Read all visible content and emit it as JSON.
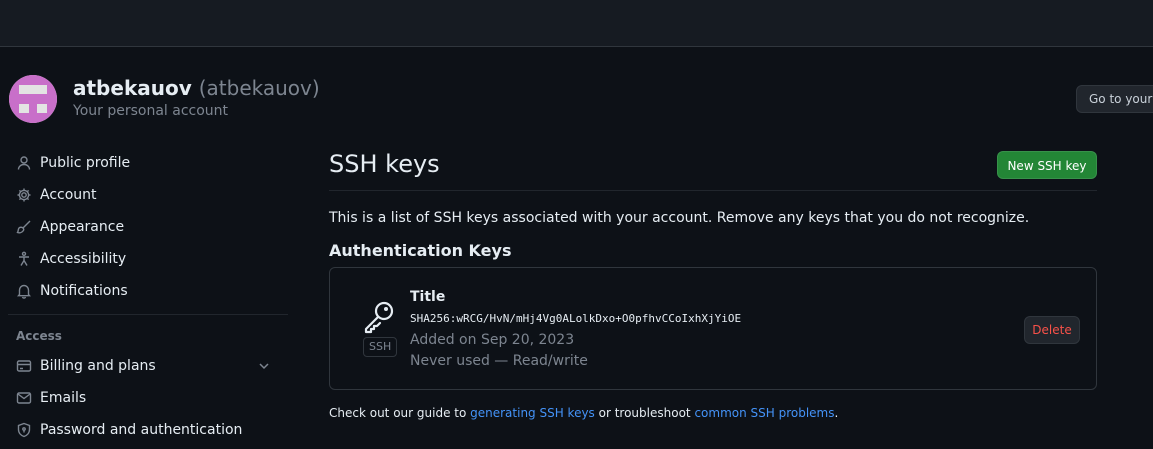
{
  "account": {
    "display_name": "atbekauov",
    "login": "(atbekauov)",
    "subtitle": "Your personal account",
    "goto_label": "Go to your"
  },
  "sidebar": {
    "items": [
      {
        "label": "Public profile",
        "icon": "person-icon"
      },
      {
        "label": "Account",
        "icon": "gear-icon"
      },
      {
        "label": "Appearance",
        "icon": "paintbrush-icon"
      },
      {
        "label": "Accessibility",
        "icon": "accessibility-icon"
      },
      {
        "label": "Notifications",
        "icon": "bell-icon"
      }
    ],
    "access_heading": "Access",
    "access_items": [
      {
        "label": "Billing and plans",
        "icon": "credit-card-icon",
        "expandable": true
      },
      {
        "label": "Emails",
        "icon": "mail-icon"
      },
      {
        "label": "Password and authentication",
        "icon": "shield-lock-icon"
      }
    ]
  },
  "main": {
    "title": "SSH keys",
    "new_key_label": "New SSH key",
    "intro": "This is a list of SSH keys associated with your account. Remove any keys that you do not recognize.",
    "section_heading": "Authentication Keys",
    "keys": [
      {
        "badge": "SSH",
        "title": "Title",
        "fingerprint": "SHA256:wRCG/HvN/mHj4Vg0ALolkDxo+O0pfhvCCoIxhXjYiOE",
        "added": "Added on Sep 20, 2023",
        "usage": "Never used — Read/write",
        "delete_label": "Delete"
      }
    ],
    "footer": {
      "prefix": "Check out our guide to ",
      "link1": "generating SSH keys",
      "middle": " or troubleshoot ",
      "link2": "common SSH problems",
      "suffix": "."
    }
  },
  "colors": {
    "background": "#0d1117",
    "primary_button": "#238636",
    "danger": "#f85149",
    "link": "#4493f8",
    "muted": "#7d8590"
  }
}
